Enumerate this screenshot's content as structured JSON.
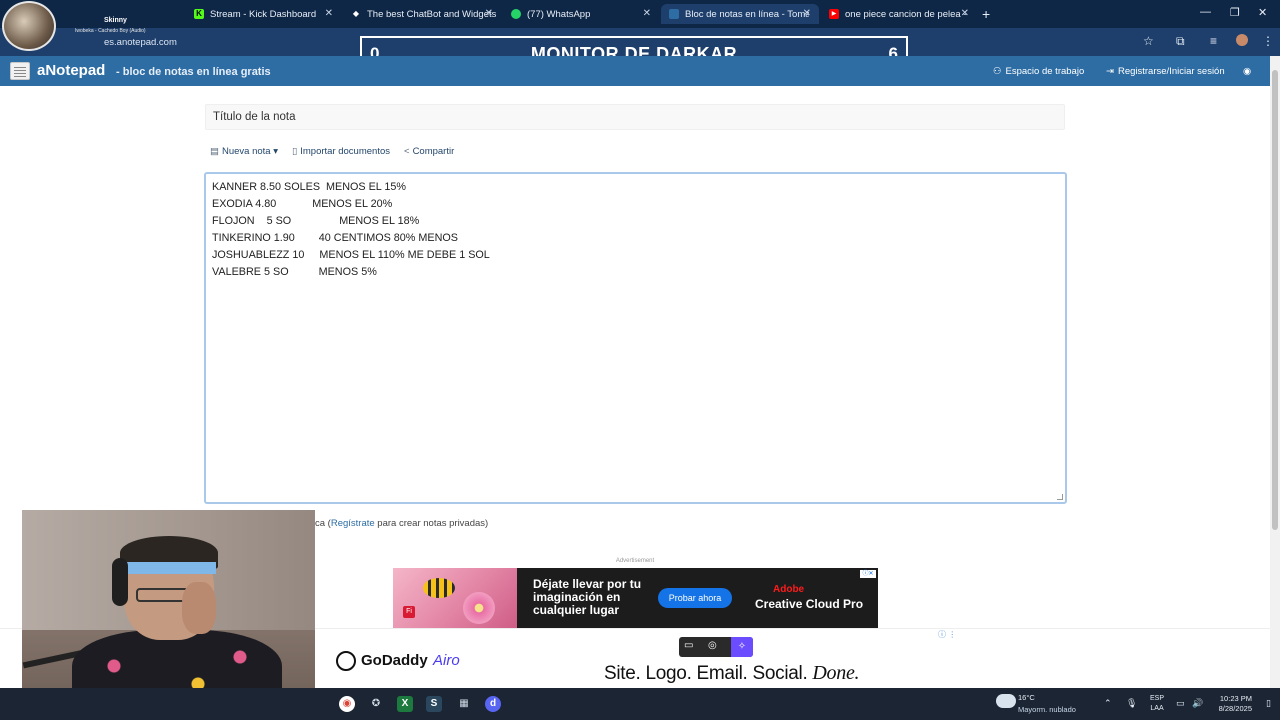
{
  "browser": {
    "tabs": [
      {
        "label": "Stream - Kick Dashboard",
        "favicon": "K",
        "color": "#53fc18",
        "active": false
      },
      {
        "label": "The best ChatBot and Widgets",
        "favicon": "◆",
        "color": "#ffffff",
        "active": false
      },
      {
        "label": "(77) WhatsApp",
        "favicon": "W",
        "color": "#25d366",
        "active": false
      },
      {
        "label": "Bloc de notas en línea - Toma y",
        "favicon": "N",
        "color": "#2e6da4",
        "active": true
      },
      {
        "label": "one piece cancion de pelea - Yo",
        "favicon": "▶",
        "color": "#ff0000",
        "active": false
      }
    ],
    "new_tab": "+",
    "url": "es.anotepad.com"
  },
  "stream_overlay": {
    "name": "Skinny",
    "song": "Iwobeka - Cachedo Boy (Audio)"
  },
  "monitor": {
    "title": "MONITOR DE DARKAR",
    "left_count": "0",
    "right_count": "6"
  },
  "site": {
    "brand": "aNotepad",
    "tagline": "- bloc de notas en línea gratis",
    "workspace": "Espacio de trabajo",
    "login": "Registrarse/Iniciar sesión"
  },
  "note": {
    "title_placeholder": "Título de la nota",
    "actions": {
      "new_note": "Nueva nota",
      "import_docs": "Importar documentos",
      "share": "Compartir"
    },
    "lines": [
      "KANNER 8.50 SOLES  MENOS EL 15%",
      "EXODIA 4.80            MENOS EL 20%",
      "FLOJON    5 SO                MENOS EL 18%",
      "TINKERINO 1.90        40 CENTIMOS 80% MENOS",
      "JOSHUABLEZZ 10     MENOS EL 110% ME DEBE 1 SOL",
      "VALEBRE 5 SO          MENOS 5%"
    ],
    "footnote_prefix": "ca (",
    "footnote_link": "Regístrate",
    "footnote_suffix": " para crear notas privadas)"
  },
  "ad": {
    "label": "Advertisement",
    "copy": "Déjate llevar por tu imaginación en cualquier lugar",
    "cta": "Probar ahora",
    "brand": "Adobe",
    "product": "Creative Cloud Pro"
  },
  "bottom_ad": {
    "brand": "GoDaddy",
    "sub": "Airo",
    "tagline": "Site. Logo. Email. Social.",
    "done": "Done."
  },
  "taskbar": {
    "temperature": "16°C",
    "weather": "Mayorm. nublado",
    "lang_top": "ESP",
    "lang_bottom": "LAA",
    "time": "10:23 PM",
    "date": "8/28/2025"
  }
}
